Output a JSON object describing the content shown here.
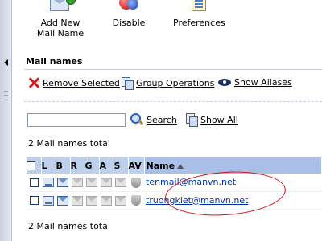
{
  "toolbar": {
    "add_label": "Add New Mail Name",
    "disable_label": "Disable",
    "preferences_label": "Preferences"
  },
  "section": {
    "title": "Mail names"
  },
  "actions": {
    "remove_label": "Remove Selected",
    "group_label": "Group Operations",
    "aliases_label": "Show Aliases"
  },
  "search": {
    "value": "",
    "search_label": "Search",
    "show_all_label": "Show All"
  },
  "totals": {
    "top": "2 Mail names total",
    "bottom": "2 Mail names total"
  },
  "table": {
    "headers": [
      "L",
      "B",
      "R",
      "G",
      "A",
      "S",
      "AV",
      "Name"
    ],
    "rows": [
      {
        "name": "tenmail@manvn.net"
      },
      {
        "name": "truongkiet@manvn.net"
      }
    ]
  },
  "colors": {
    "header_bg": "#bfd0ed",
    "link": "#0033aa",
    "highlight": "#d0101a"
  }
}
